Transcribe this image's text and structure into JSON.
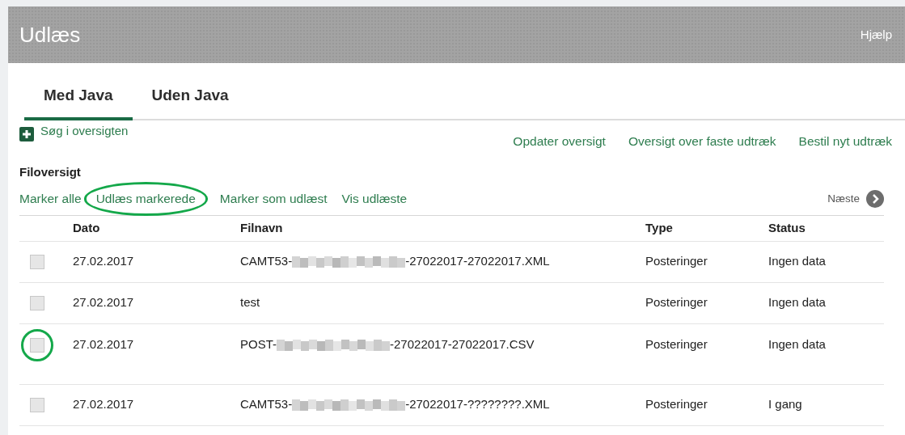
{
  "header": {
    "title": "Udlæs",
    "help": "Hjælp"
  },
  "tabs": [
    {
      "label": "Med Java",
      "selected": true
    },
    {
      "label": "Uden Java",
      "selected": false
    }
  ],
  "search_toggle": {
    "label": "Søg i oversigten",
    "expanded": false
  },
  "top_links": [
    "Opdater oversigt",
    "Oversigt over faste udtræk",
    "Bestil nyt udtræk"
  ],
  "section_title": "Filoversigt",
  "actions": [
    {
      "label": "Marker alle",
      "circled": false
    },
    {
      "label": "Udlæs markerede",
      "circled": true
    },
    {
      "label": "Marker som udlæst",
      "circled": false
    },
    {
      "label": "Vis udlæste",
      "circled": false
    }
  ],
  "next": "Næste",
  "table": {
    "columns": [
      "Dato",
      "Filnavn",
      "Type",
      "Status"
    ],
    "rows": [
      {
        "checked": false,
        "circled": false,
        "date": "27.02.2017",
        "name_prefix": "CAMT53-",
        "redacted": true,
        "name_suffix": "-27022017-27022017.XML",
        "type": "Posteringer",
        "status": "Ingen data"
      },
      {
        "checked": false,
        "circled": false,
        "date": "27.02.2017",
        "name_prefix": "test",
        "redacted": false,
        "name_suffix": "",
        "type": "Posteringer",
        "status": "Ingen data"
      },
      {
        "checked": false,
        "circled": true,
        "date": "27.02.2017",
        "name_prefix": "POST-",
        "redacted": true,
        "name_suffix": "-27022017-27022017.CSV",
        "type": "Posteringer",
        "status": "Ingen data"
      },
      {
        "checked": false,
        "circled": false,
        "date": "27.02.2017",
        "name_prefix": "CAMT53-",
        "redacted": true,
        "name_suffix": "-27022017-????????.XML",
        "type": "Posteringer",
        "status": "I gang"
      }
    ]
  }
}
